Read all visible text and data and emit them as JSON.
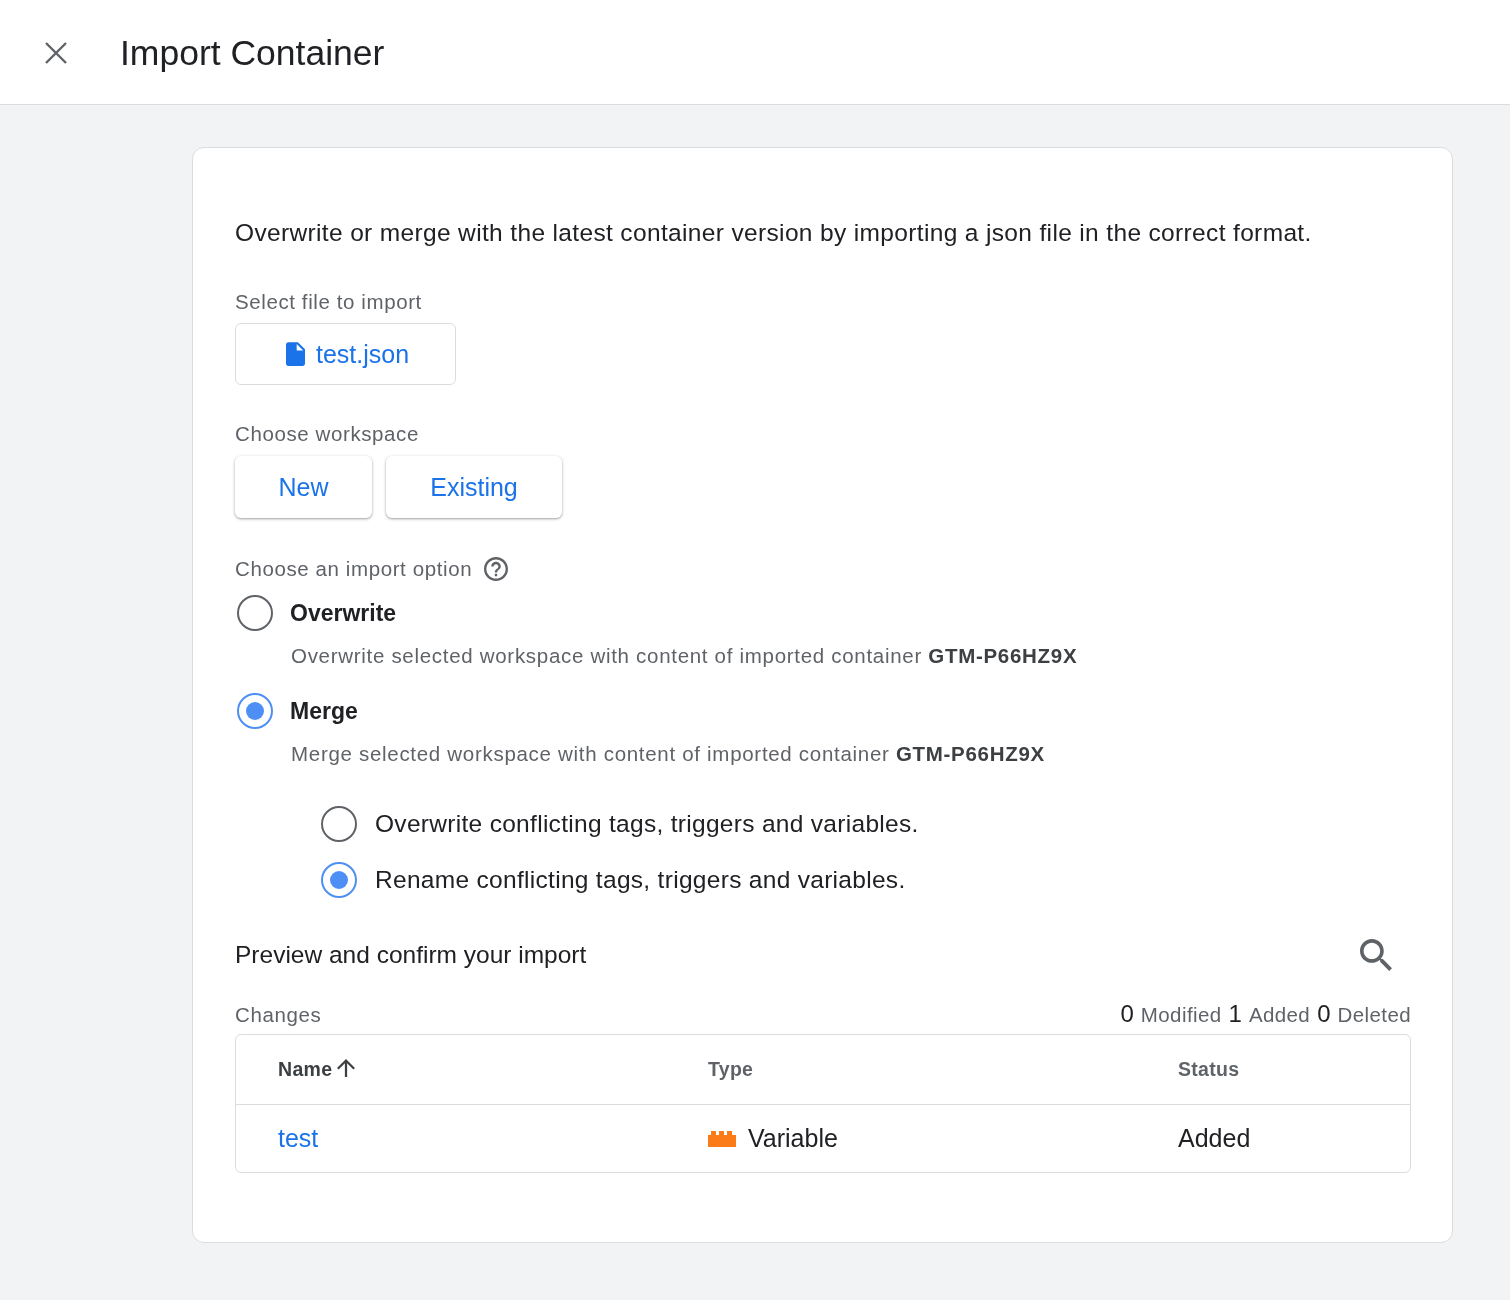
{
  "header": {
    "title": "Import Container"
  },
  "intro": "Overwrite or merge with the latest container version by importing a json file in the correct format.",
  "file_select": {
    "label": "Select file to import",
    "file_name": "test.json"
  },
  "workspace": {
    "label": "Choose workspace",
    "buttons": [
      "New",
      "Existing"
    ]
  },
  "import_option": {
    "label": "Choose an import option",
    "options": [
      {
        "label": "Overwrite",
        "description": "Overwrite selected workspace with content of imported container **GTM-P66HZ9X**",
        "selected": false
      },
      {
        "label": "Merge",
        "description": "Merge selected workspace with content of imported container **GTM-P66HZ9X**",
        "selected": true,
        "sub_options": [
          {
            "label": "Overwrite conflicting tags, triggers and variables.",
            "selected": false
          },
          {
            "label": "Rename conflicting tags, triggers and variables.",
            "selected": true
          }
        ]
      }
    ]
  },
  "preview": {
    "title": "Preview and confirm your import",
    "changes_label": "Changes",
    "summary": [
      {
        "count": "0",
        "label": "Modified"
      },
      {
        "count": "1",
        "label": "Added"
      },
      {
        "count": "0",
        "label": "Deleted"
      }
    ],
    "table": {
      "columns": [
        {
          "label": "Name",
          "sorted_ascending": true
        },
        {
          "label": "Type",
          "sorted_ascending": false
        },
        {
          "label": "Status",
          "sorted_ascending": false
        }
      ],
      "rows": [
        {
          "name": "test",
          "type": "Variable",
          "status": "Added"
        }
      ]
    }
  }
}
